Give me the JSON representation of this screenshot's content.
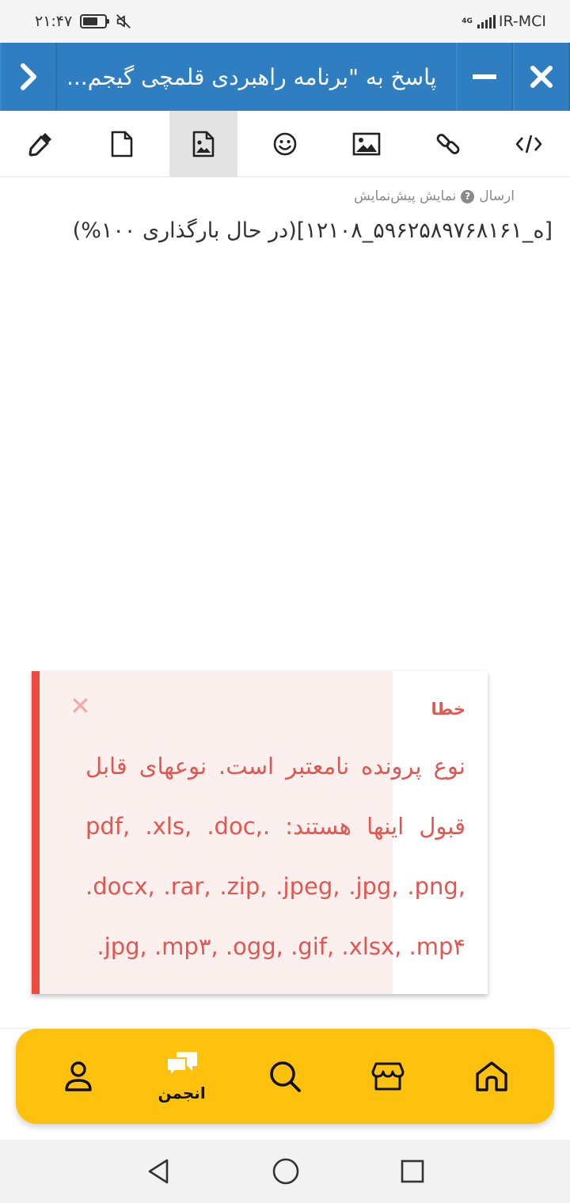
{
  "status_bar": {
    "time": "۲۱:۴۷",
    "network_type": "4G",
    "carrier": "IR-MCI"
  },
  "header": {
    "title": "پاسخ به \"برنامه راهبردی قلمچی گیجم...",
    "icons": [
      "chevron-right-icon",
      "minimize-icon",
      "close-icon"
    ]
  },
  "toolbar": {
    "tools": [
      "color-picker-icon",
      "file-icon",
      "image-file-icon",
      "emoji-icon",
      "image-icon",
      "link-icon",
      "code-icon"
    ]
  },
  "editor": {
    "send_label": "ارسال",
    "preview_label": "نمایش پیش‌نمایش",
    "content": "[ه_۵۹۶۲۵۸۹۷۶۸۱۶۱_۱۲۱۰۸](در حال بارگذاری ۱۰۰%)"
  },
  "error_toast": {
    "title": "خطا",
    "message": "نوع پرونده نامعتبر است. نوعهای قابل قبول اینها هستند: .pdf, .xls, .doc, .docx, .rar, .zip, .jpeg, .jpg, .png, .jpg, .mp۳, .ogg, .gif, .xlsx, .mp۴",
    "close_symbol": "✕",
    "accent_color": "#ef4a42"
  },
  "bottom_nav": {
    "active_label": "انجمن",
    "items": [
      "profile-icon",
      "forum-icon",
      "search-icon",
      "store-icon",
      "home-icon"
    ],
    "background_color": "#fec10d"
  }
}
